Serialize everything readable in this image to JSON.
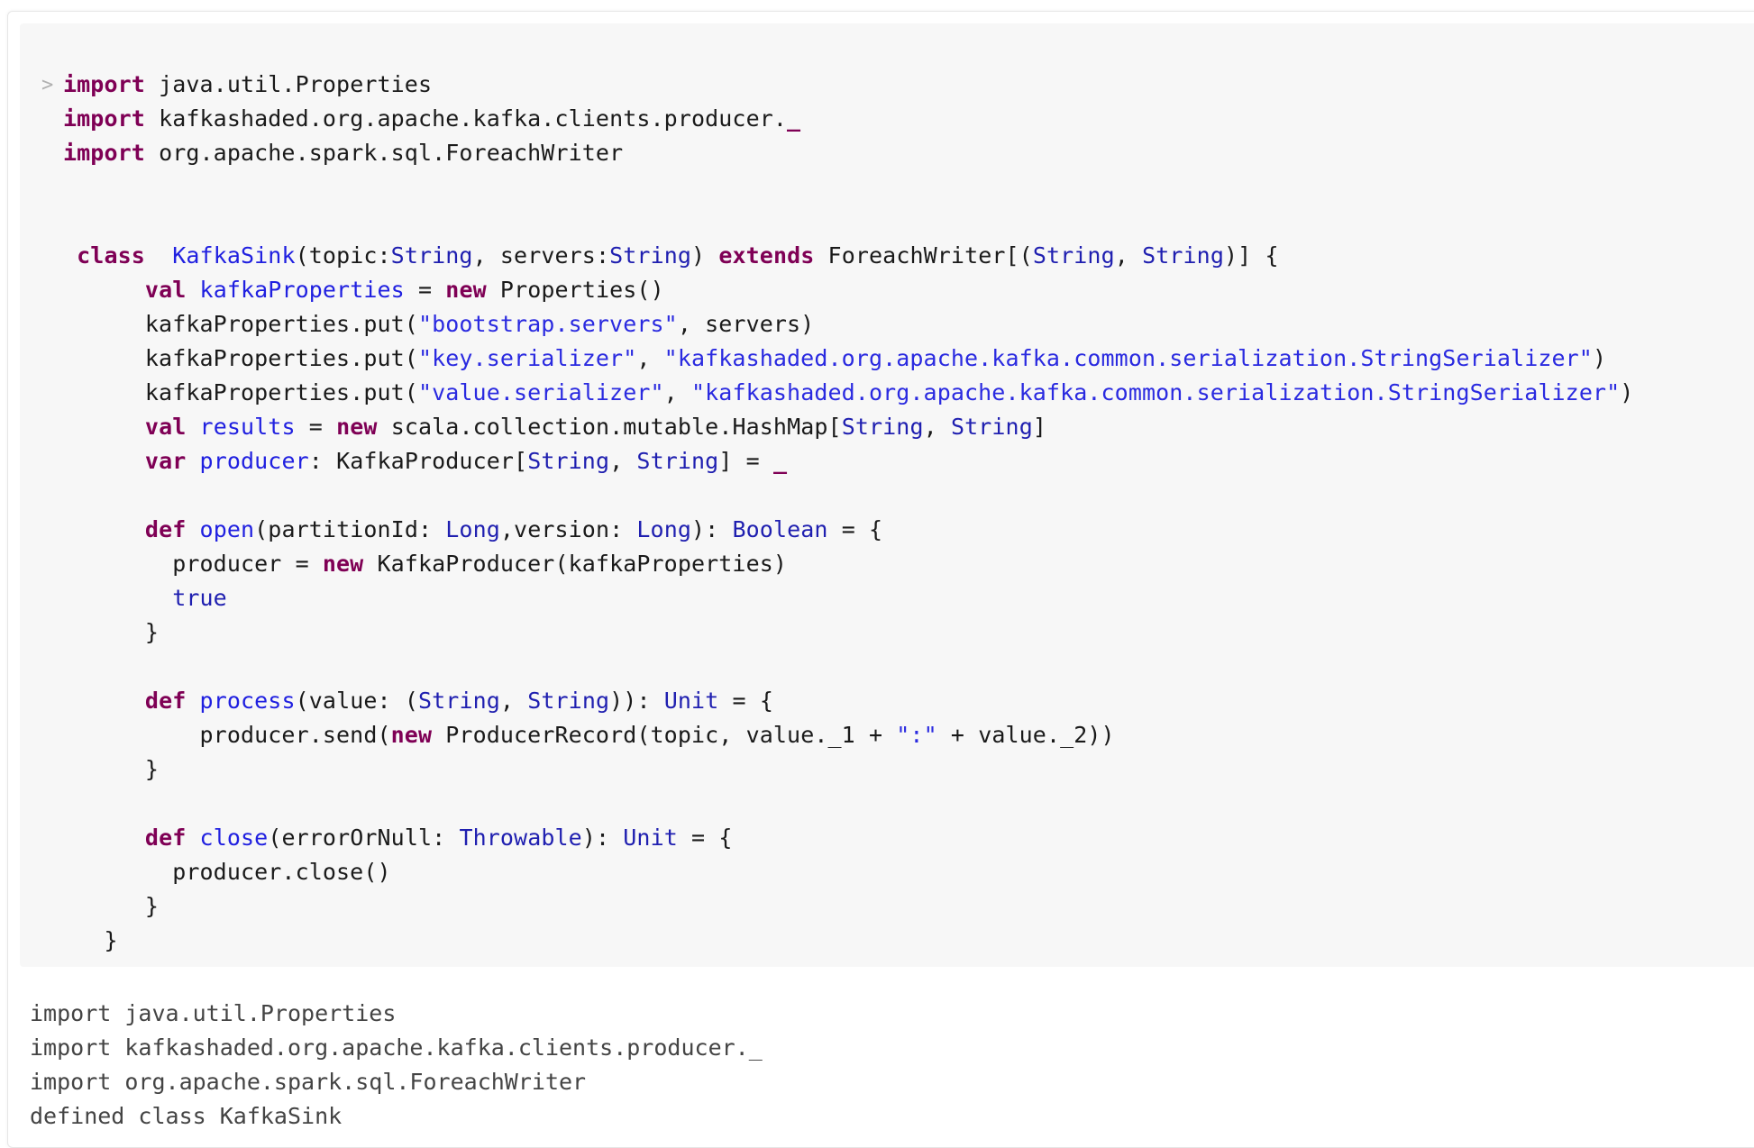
{
  "cell": {
    "prompt_icon": "chevron-right-icon",
    "prompt_glyph": ">",
    "colors": {
      "keyword": "#7f0055",
      "definition": "#2020e0",
      "type": "#1f1fb0",
      "string": "#2a2ae0",
      "plain": "#1a1a1a",
      "output": "#444444",
      "code_background": "#f7f7f7"
    },
    "code_lines": [
      [
        {
          "t": "kw",
          "v": "import"
        },
        {
          "t": "p",
          "v": " java.util.Properties"
        }
      ],
      [
        {
          "t": "kw",
          "v": "import"
        },
        {
          "t": "p",
          "v": " kafkashaded.org.apache.kafka.clients.producer."
        },
        {
          "t": "und",
          "v": "_"
        }
      ],
      [
        {
          "t": "kw",
          "v": "import"
        },
        {
          "t": "p",
          "v": " org.apache.spark.sql.ForeachWriter"
        }
      ],
      [],
      [],
      [
        {
          "t": "p",
          "v": " "
        },
        {
          "t": "kw",
          "v": "class"
        },
        {
          "t": "p",
          "v": "  "
        },
        {
          "t": "def",
          "v": "KafkaSink"
        },
        {
          "t": "p",
          "v": "(topic:"
        },
        {
          "t": "ty",
          "v": "String"
        },
        {
          "t": "p",
          "v": ", servers:"
        },
        {
          "t": "ty",
          "v": "String"
        },
        {
          "t": "p",
          "v": ") "
        },
        {
          "t": "kw",
          "v": "extends"
        },
        {
          "t": "p",
          "v": " ForeachWriter[("
        },
        {
          "t": "ty",
          "v": "String"
        },
        {
          "t": "p",
          "v": ", "
        },
        {
          "t": "ty",
          "v": "String"
        },
        {
          "t": "p",
          "v": ")] {"
        }
      ],
      [
        {
          "t": "p",
          "v": "      "
        },
        {
          "t": "kw",
          "v": "val"
        },
        {
          "t": "p",
          "v": " "
        },
        {
          "t": "def",
          "v": "kafkaProperties"
        },
        {
          "t": "p",
          "v": " = "
        },
        {
          "t": "kw",
          "v": "new"
        },
        {
          "t": "p",
          "v": " Properties()"
        }
      ],
      [
        {
          "t": "p",
          "v": "      kafkaProperties.put("
        },
        {
          "t": "str",
          "v": "\"bootstrap.servers\""
        },
        {
          "t": "p",
          "v": ", servers)"
        }
      ],
      [
        {
          "t": "p",
          "v": "      kafkaProperties.put("
        },
        {
          "t": "str",
          "v": "\"key.serializer\""
        },
        {
          "t": "p",
          "v": ", "
        },
        {
          "t": "str",
          "v": "\"kafkashaded.org.apache.kafka.common.serialization.StringSerializer\""
        },
        {
          "t": "p",
          "v": ")"
        }
      ],
      [
        {
          "t": "p",
          "v": "      kafkaProperties.put("
        },
        {
          "t": "str",
          "v": "\"value.serializer\""
        },
        {
          "t": "p",
          "v": ", "
        },
        {
          "t": "str",
          "v": "\"kafkashaded.org.apache.kafka.common.serialization.StringSerializer\""
        },
        {
          "t": "p",
          "v": ")"
        }
      ],
      [
        {
          "t": "p",
          "v": "      "
        },
        {
          "t": "kw",
          "v": "val"
        },
        {
          "t": "p",
          "v": " "
        },
        {
          "t": "def",
          "v": "results"
        },
        {
          "t": "p",
          "v": " = "
        },
        {
          "t": "kw",
          "v": "new"
        },
        {
          "t": "p",
          "v": " scala.collection.mutable.HashMap["
        },
        {
          "t": "ty",
          "v": "String"
        },
        {
          "t": "p",
          "v": ", "
        },
        {
          "t": "ty",
          "v": "String"
        },
        {
          "t": "p",
          "v": "]"
        }
      ],
      [
        {
          "t": "p",
          "v": "      "
        },
        {
          "t": "kw",
          "v": "var"
        },
        {
          "t": "p",
          "v": " "
        },
        {
          "t": "def",
          "v": "producer"
        },
        {
          "t": "p",
          "v": ": KafkaProducer["
        },
        {
          "t": "ty",
          "v": "String"
        },
        {
          "t": "p",
          "v": ", "
        },
        {
          "t": "ty",
          "v": "String"
        },
        {
          "t": "p",
          "v": "] = "
        },
        {
          "t": "und",
          "v": "_"
        }
      ],
      [],
      [
        {
          "t": "p",
          "v": "      "
        },
        {
          "t": "kw",
          "v": "def"
        },
        {
          "t": "p",
          "v": " "
        },
        {
          "t": "def",
          "v": "open"
        },
        {
          "t": "p",
          "v": "(partitionId: "
        },
        {
          "t": "ty",
          "v": "Long"
        },
        {
          "t": "p",
          "v": ",version: "
        },
        {
          "t": "ty",
          "v": "Long"
        },
        {
          "t": "p",
          "v": "): "
        },
        {
          "t": "ty",
          "v": "Boolean"
        },
        {
          "t": "p",
          "v": " = {"
        }
      ],
      [
        {
          "t": "p",
          "v": "        producer = "
        },
        {
          "t": "kw",
          "v": "new"
        },
        {
          "t": "p",
          "v": " KafkaProducer(kafkaProperties)"
        }
      ],
      [
        {
          "t": "p",
          "v": "        "
        },
        {
          "t": "lit",
          "v": "true"
        }
      ],
      [
        {
          "t": "p",
          "v": "      }"
        }
      ],
      [],
      [
        {
          "t": "p",
          "v": "      "
        },
        {
          "t": "kw",
          "v": "def"
        },
        {
          "t": "p",
          "v": " "
        },
        {
          "t": "def",
          "v": "process"
        },
        {
          "t": "p",
          "v": "(value: ("
        },
        {
          "t": "ty",
          "v": "String"
        },
        {
          "t": "p",
          "v": ", "
        },
        {
          "t": "ty",
          "v": "String"
        },
        {
          "t": "p",
          "v": ")): "
        },
        {
          "t": "ty",
          "v": "Unit"
        },
        {
          "t": "p",
          "v": " = {"
        }
      ],
      [
        {
          "t": "p",
          "v": "          producer.send("
        },
        {
          "t": "kw",
          "v": "new"
        },
        {
          "t": "p",
          "v": " ProducerRecord(topic, value._1 + "
        },
        {
          "t": "str",
          "v": "\":\""
        },
        {
          "t": "p",
          "v": " + value._2))"
        }
      ],
      [
        {
          "t": "p",
          "v": "      }"
        }
      ],
      [],
      [
        {
          "t": "p",
          "v": "      "
        },
        {
          "t": "kw",
          "v": "def"
        },
        {
          "t": "p",
          "v": " "
        },
        {
          "t": "def",
          "v": "close"
        },
        {
          "t": "p",
          "v": "(errorOrNull: "
        },
        {
          "t": "ty",
          "v": "Throwable"
        },
        {
          "t": "p",
          "v": "): "
        },
        {
          "t": "ty",
          "v": "Unit"
        },
        {
          "t": "p",
          "v": " = {"
        }
      ],
      [
        {
          "t": "p",
          "v": "        producer.close()"
        }
      ],
      [
        {
          "t": "p",
          "v": "      }"
        }
      ],
      [
        {
          "t": "p",
          "v": "   }"
        }
      ]
    ],
    "output_lines": [
      "import java.util.Properties",
      "import kafkashaded.org.apache.kafka.clients.producer._",
      "import org.apache.spark.sql.ForeachWriter",
      "defined class KafkaSink"
    ]
  }
}
